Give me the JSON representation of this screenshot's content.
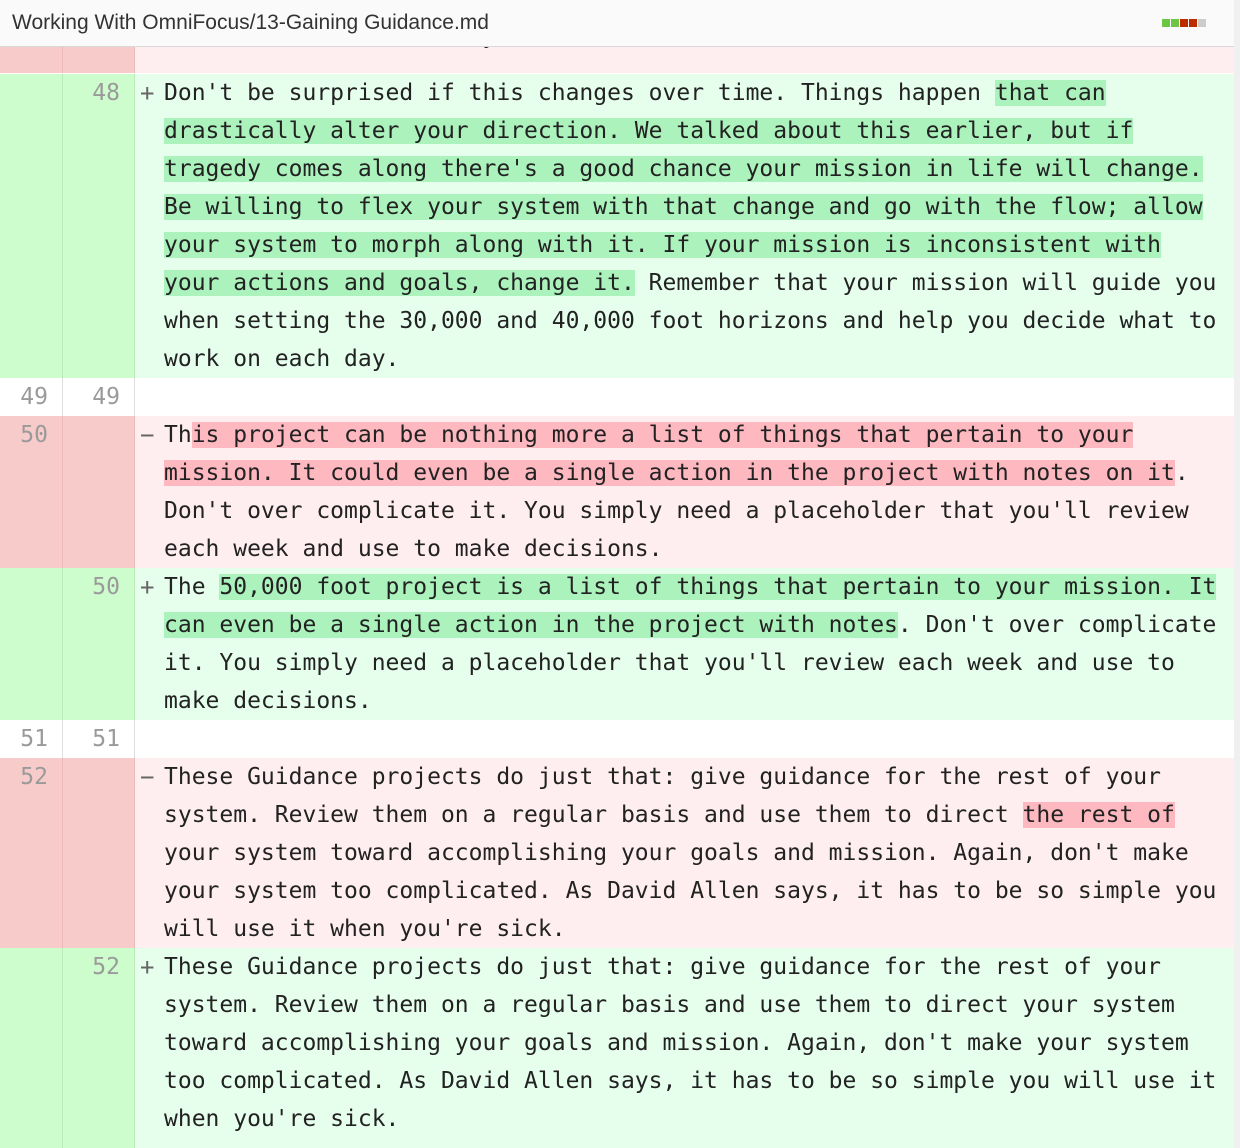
{
  "header": {
    "file_path": "Working With OmniFocus/13-Gaining Guidance.md",
    "stat_colors": [
      "#6cc644",
      "#6cc644",
      "#bd2c00",
      "#bd2c00",
      "#cccccc"
    ]
  },
  "diff": {
    "partial_line": "what to work on each day.",
    "rows": [
      {
        "type": "add",
        "old": "",
        "new": "48",
        "sign": "+",
        "segments": [
          {
            "t": "Don't be surprised if this changes over time. Things happen ",
            "hl": false
          },
          {
            "t": "that can drastically alter your direction. We talked about this earlier, but if tragedy comes along there's a good chance your mission in life will change. Be willing to flex your system with that change and go with the flow; allow your system to morph along with it. If your mission is inconsistent with your actions and goals, change it.",
            "hl": true
          },
          {
            "t": " Remember that your mission will guide you when setting the 30,000 and 40,000 foot horizons and help you decide what to work on each day.",
            "hl": false
          }
        ]
      },
      {
        "type": "ctx",
        "old": "49",
        "new": "49",
        "sign": "",
        "segments": [
          {
            "t": "",
            "hl": false
          }
        ]
      },
      {
        "type": "del",
        "old": "50",
        "new": "",
        "sign": "−",
        "segments": [
          {
            "t": "Th",
            "hl": false
          },
          {
            "t": "is project can be nothing more a list of things that pertain to your mission. It could even be a single action in the project with notes on it",
            "hl": true
          },
          {
            "t": ". Don't over complicate it. You simply need a placeholder that you'll review each week and use to make decisions.",
            "hl": false
          }
        ]
      },
      {
        "type": "add",
        "old": "",
        "new": "50",
        "sign": "+",
        "segments": [
          {
            "t": "The ",
            "hl": false
          },
          {
            "t": "50,000 foot project is a list of things that pertain to your mission. It can even be a single action in the project with notes",
            "hl": true
          },
          {
            "t": ". Don't over complicate it. You simply need a placeholder that you'll review each week and use to make decisions.",
            "hl": false
          }
        ]
      },
      {
        "type": "ctx",
        "old": "51",
        "new": "51",
        "sign": "",
        "segments": [
          {
            "t": "",
            "hl": false
          }
        ]
      },
      {
        "type": "del",
        "old": "52",
        "new": "",
        "sign": "−",
        "segments": [
          {
            "t": "These Guidance projects do just that: give guidance for the rest of your system. Review them on a regular basis and use them to direct ",
            "hl": false
          },
          {
            "t": "the rest of ",
            "hl": true
          },
          {
            "t": "your system toward accomplishing your goals and mission. Again, don't make your system too complicated. As David Allen says, it has to be so simple you will use it when you're sick.",
            "hl": false
          }
        ]
      },
      {
        "type": "add",
        "old": "",
        "new": "52",
        "sign": "+",
        "segments": [
          {
            "t": "These Guidance projects do just that: give guidance for the rest of your system. Review them on a regular basis and use them to direct your system toward accomplishing your goals and mission. Again, don't make your system too complicated. As David Allen says, it has to be so simple you will use it when you're sick.",
            "hl": false
          }
        ]
      }
    ]
  }
}
